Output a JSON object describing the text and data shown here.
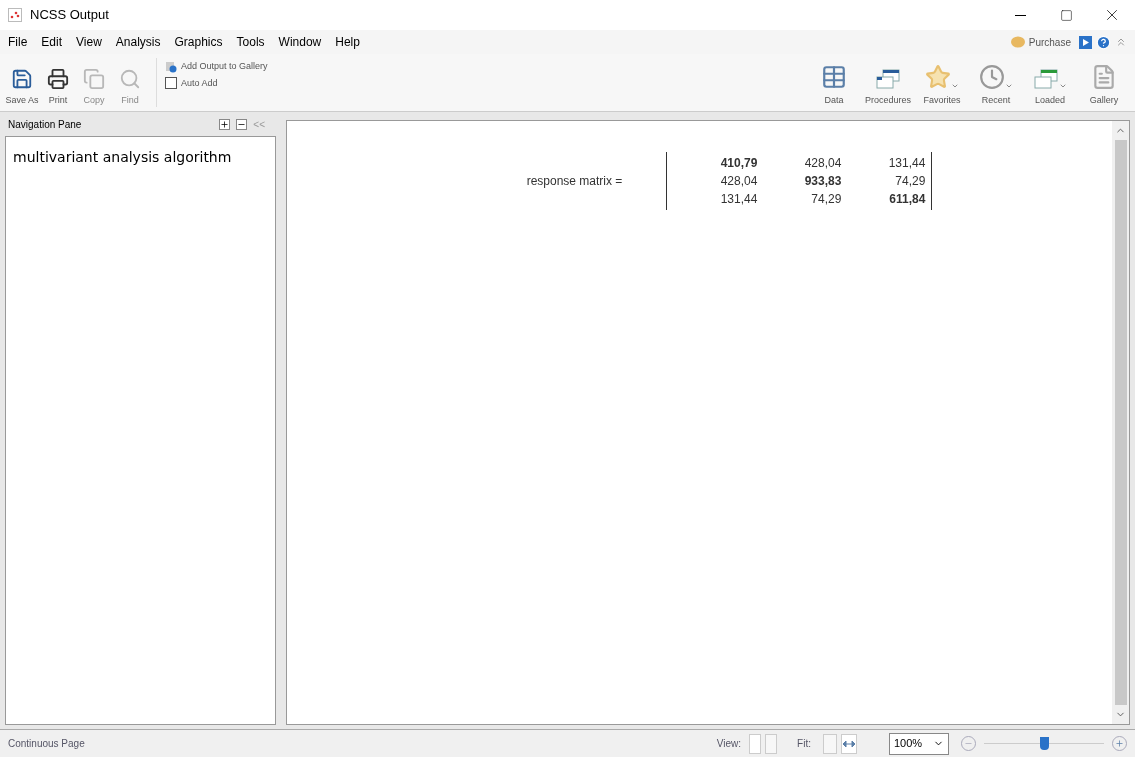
{
  "window": {
    "title": "NCSS Output"
  },
  "menu": [
    "File",
    "Edit",
    "View",
    "Analysis",
    "Graphics",
    "Tools",
    "Window",
    "Help"
  ],
  "purchase": "Purchase",
  "toolbar_left": [
    {
      "label": "Save As",
      "kind": "save",
      "disabled": false
    },
    {
      "label": "Print",
      "kind": "print",
      "disabled": false
    },
    {
      "label": "Copy",
      "kind": "copy",
      "disabled": true
    },
    {
      "label": "Find",
      "kind": "find",
      "disabled": true
    }
  ],
  "gallery": {
    "add": "Add Output to Gallery",
    "auto_add": "Auto Add",
    "auto_add_checked": false
  },
  "toolbar_right": [
    {
      "label": "Data",
      "kind": "data",
      "dropdown": false
    },
    {
      "label": "Procedures",
      "kind": "procedures",
      "dropdown": false
    },
    {
      "label": "Favorites",
      "kind": "favorites",
      "dropdown": true
    },
    {
      "label": "Recent",
      "kind": "recent",
      "dropdown": true
    },
    {
      "label": "Loaded",
      "kind": "loaded",
      "dropdown": true
    },
    {
      "label": "Gallery",
      "kind": "gallery",
      "dropdown": false
    }
  ],
  "navigation": {
    "title": "Navigation Pane",
    "collapse": "<<",
    "items": [
      "multivariant analysis algorithm"
    ]
  },
  "matrix": {
    "label": "response matrix =",
    "rows": [
      [
        {
          "value": "410,79",
          "bold": true
        },
        {
          "value": "428,04",
          "bold": false
        },
        {
          "value": "131,44",
          "bold": false
        }
      ],
      [
        {
          "value": "428,04",
          "bold": false
        },
        {
          "value": "933,83",
          "bold": true
        },
        {
          "value": "74,29",
          "bold": false
        }
      ],
      [
        {
          "value": "131,44",
          "bold": false
        },
        {
          "value": "74,29",
          "bold": false
        },
        {
          "value": "611,84",
          "bold": true
        }
      ]
    ]
  },
  "status_bar": {
    "mode": "Continuous Page",
    "view_label": "View:",
    "fit_label": "Fit:",
    "zoom": "100%",
    "zoom_slider": {
      "level": 0.5
    }
  }
}
